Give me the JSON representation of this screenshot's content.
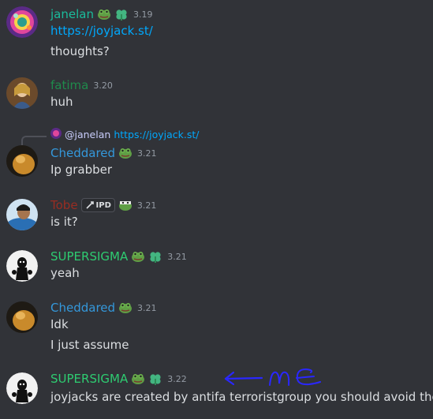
{
  "colors": {
    "background": "#313338",
    "text": "#dbdee1",
    "link": "#00a8fc",
    "timestamp": "#949ba4",
    "janelan": "#1abc9c",
    "fatima": "#1f8b4c",
    "cheddared": "#3498db",
    "tobe": "#992d22",
    "supersigma": "#2ecc71",
    "annotation": "#2a27ff"
  },
  "messages": [
    {
      "user": "janelan",
      "time": "3.19",
      "lines": [
        "https://joyjack.st/",
        "thoughts?"
      ]
    },
    {
      "user": "fatima",
      "time": "3.20",
      "lines": [
        "huh"
      ]
    },
    {
      "reply": {
        "mention": "@janelan",
        "link": "https://joyjack.st/"
      },
      "user": "Cheddared",
      "time": "3.21",
      "lines": [
        "Ip grabber"
      ]
    },
    {
      "user": "Tobe",
      "role_tag": "IPD",
      "time": "3.21",
      "lines": [
        "is it?"
      ]
    },
    {
      "user": "SUPERSIGMA",
      "time": "3.21",
      "lines": [
        "yeah"
      ]
    },
    {
      "user": "Cheddared",
      "time": "3.21",
      "lines": [
        "Idk",
        "I just assume"
      ]
    },
    {
      "user": "SUPERSIGMA",
      "time": "3.22",
      "lines": [
        "joyjacks are created by antifa terroristgroup you should avoid them"
      ]
    }
  ],
  "annotation": {
    "text": "me",
    "icon": "arrow-left-icon"
  }
}
